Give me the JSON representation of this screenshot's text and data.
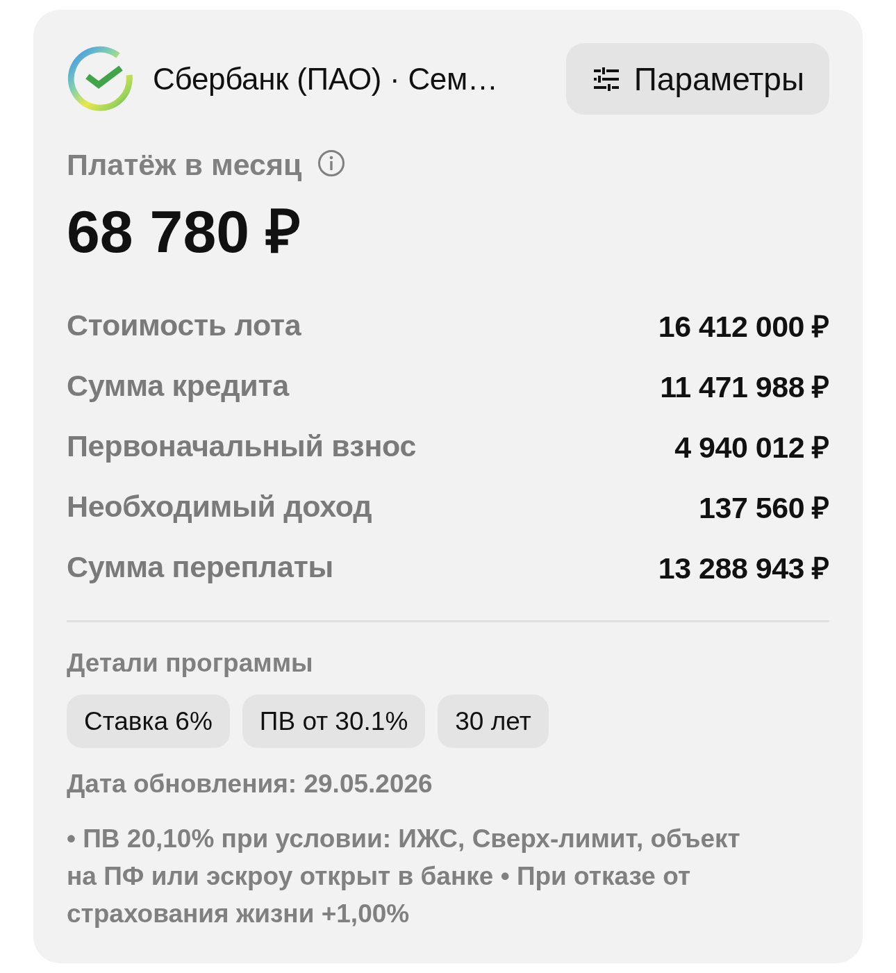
{
  "header": {
    "bank_name": "Сбербанк (ПАО) · Сем…",
    "settings_button": "Параметры"
  },
  "payment": {
    "label": "Платёж в месяц",
    "amount": "68 780 ₽"
  },
  "summary": [
    {
      "label": "Стоимость лота",
      "value": "16 412 000 ₽"
    },
    {
      "label": "Сумма кредита",
      "value": "11 471 988 ₽"
    },
    {
      "label": "Первоначальный взнос",
      "value": "4 940 012 ₽"
    },
    {
      "label": "Необходимый доход",
      "value": "137 560 ₽"
    },
    {
      "label": "Сумма переплаты",
      "value": "13 288 943 ₽"
    }
  ],
  "program": {
    "title": "Детали программы",
    "chips": [
      "Ставка 6%",
      "ПВ от 30.1%",
      "30 лет"
    ],
    "updated": "Дата обновления: 29.05.2026",
    "note": "• ПВ 20,10% при условии: ИЖС, Сверх-лимит, объект на ПФ или эскроу открыт в банке • При отказе от страхования жизни +1,00%"
  }
}
